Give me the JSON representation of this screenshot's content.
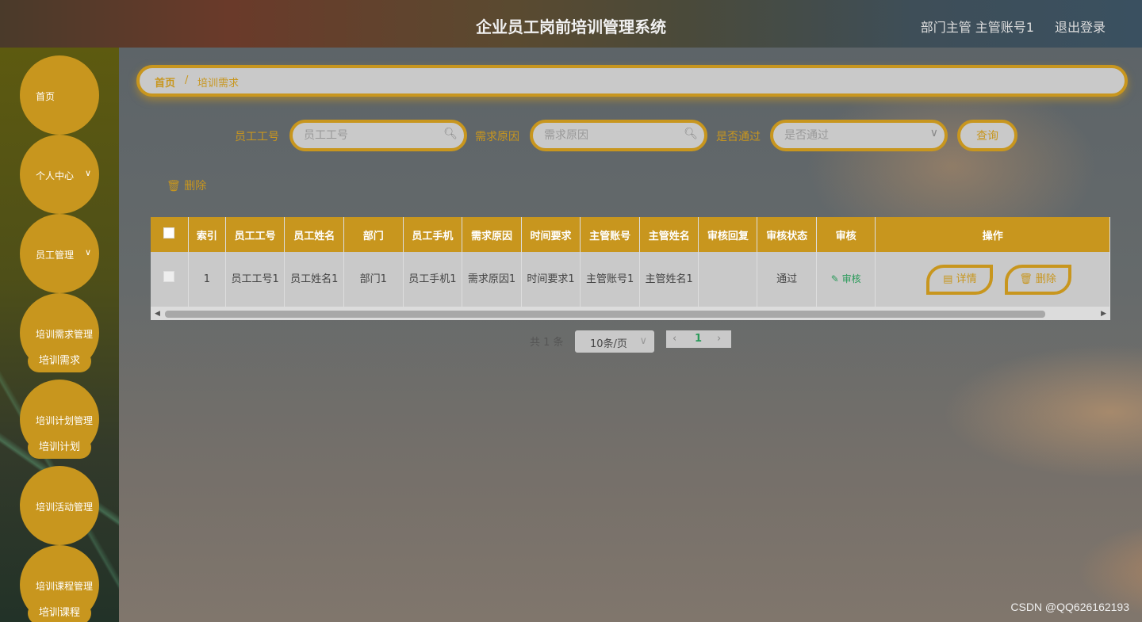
{
  "header": {
    "title": "企业员工岗前培训管理系统",
    "user": "部门主管 主管账号1",
    "logout": "退出登录"
  },
  "sidebar": {
    "home": "首页",
    "personal": "个人中心",
    "employee": "员工管理",
    "training_need_mgmt": "培训需求管理",
    "training_need": "培训需求",
    "training_plan_mgmt": "培训计划管理",
    "training_plan": "培训计划",
    "training_activity_mgmt": "培训活动管理",
    "training_course_mgmt": "培训课程管理",
    "training_course": "培训课程"
  },
  "breadcrumb": {
    "home": "首页",
    "sep": "/",
    "current": "培训需求"
  },
  "search": {
    "emp_no_label": "员工工号",
    "emp_no_placeholder": "员工工号",
    "reason_label": "需求原因",
    "reason_placeholder": "需求原因",
    "passed_label": "是否通过",
    "passed_placeholder": "是否通过",
    "query": "查询"
  },
  "actions": {
    "delete": "删除"
  },
  "table": {
    "headers": [
      "索引",
      "员工工号",
      "员工姓名",
      "部门",
      "员工手机",
      "需求原因",
      "时间要求",
      "主管账号",
      "主管姓名",
      "审核回复",
      "审核状态",
      "审核",
      "操作"
    ],
    "rows": [
      {
        "index": "1",
        "emp_no": "员工工号1",
        "emp_name": "员工姓名1",
        "dept": "部门1",
        "phone": "员工手机1",
        "reason": "需求原因1",
        "time": "时间要求1",
        "mgr_acct": "主管账号1",
        "mgr_name": "主管姓名1",
        "reply": "",
        "status": "通过",
        "audit": "审核",
        "detail": "详情",
        "delete": "删除"
      }
    ]
  },
  "pagination": {
    "total": "共 1 条",
    "page_size": "10条/页",
    "current_page": "1"
  },
  "watermark": "CSDN @QQ626162193"
}
